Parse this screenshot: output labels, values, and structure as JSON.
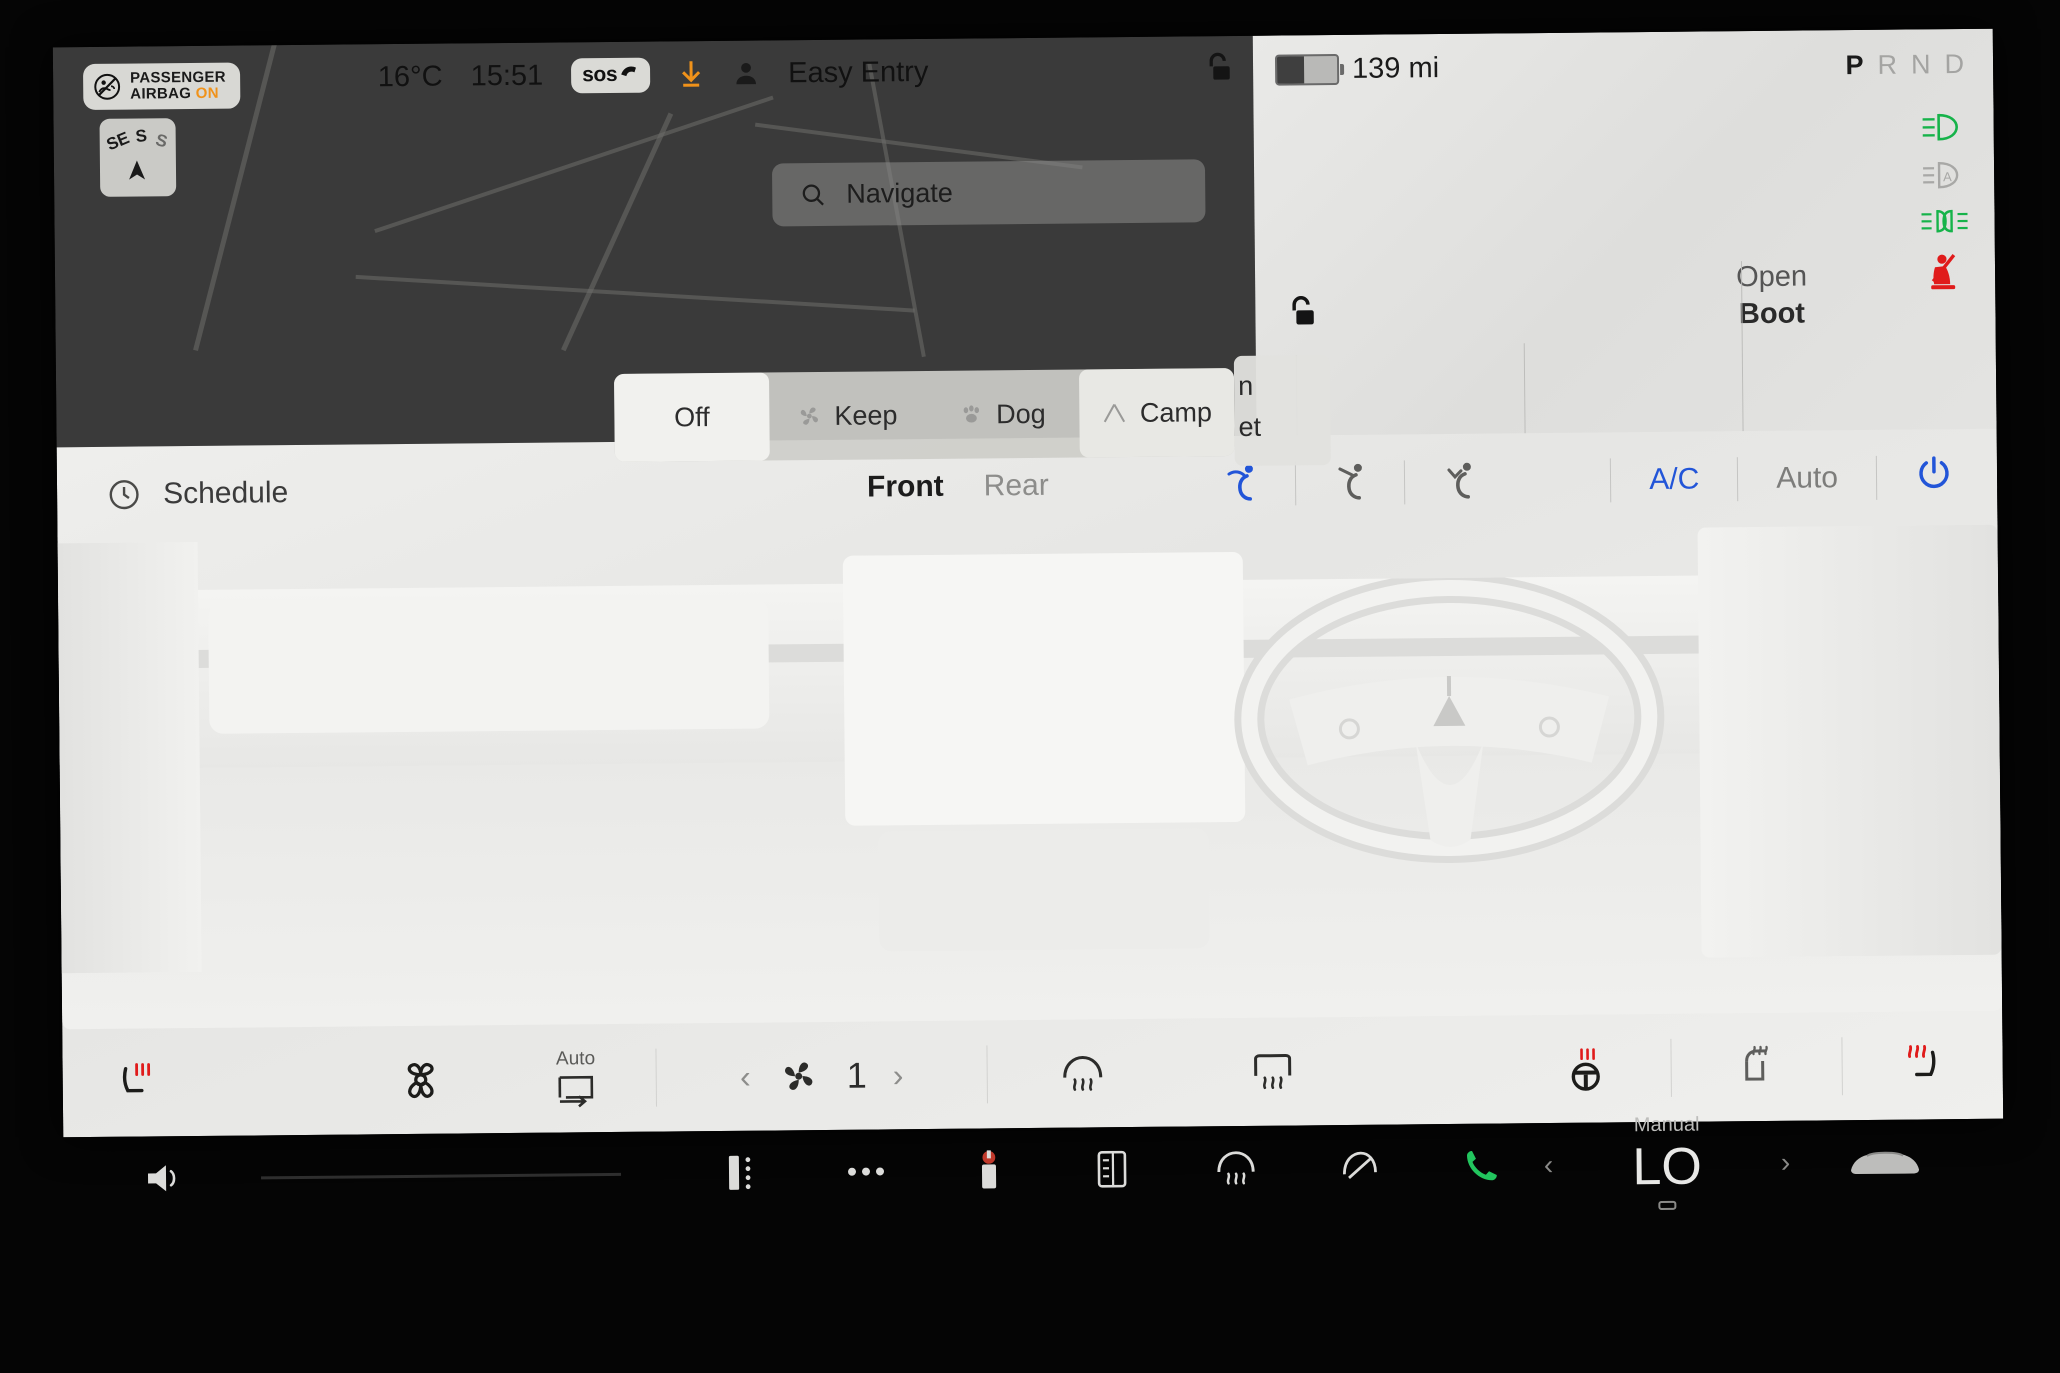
{
  "status_bar": {
    "airbag_line1": "PASSENGER",
    "airbag_line2": "AIRBAG",
    "airbag_state": "ON",
    "airbag_icon": "passenger-airbag-off-icon",
    "compass_primary": "SE",
    "compass_s": "S",
    "compass_s2": "S",
    "compass_arrow_icon": "navigation-arrow-icon",
    "temperature": "16°C",
    "clock": "15:51",
    "sos_label": "sos",
    "sos_icon": "phone-handset-icon",
    "download_icon": "software-update-download-icon",
    "profile_icon": "person-icon",
    "profile_name": "Easy Entry",
    "lock_icon": "unlocked-padlock-icon"
  },
  "navigation": {
    "search_icon": "search-icon",
    "placeholder": "Navigate"
  },
  "car_panel": {
    "battery_icon": "battery-icon",
    "battery_percent": 45,
    "range": "139 mi",
    "gears": [
      {
        "letter": "P",
        "active": true
      },
      {
        "letter": "R",
        "active": false
      },
      {
        "letter": "N",
        "active": false
      },
      {
        "letter": "D",
        "active": false
      }
    ],
    "telltales": [
      {
        "name": "low-beam-headlight-icon",
        "color": "#16b34a",
        "state": "on"
      },
      {
        "name": "auto-headlight-icon",
        "color": "#9e9e9c",
        "state": "off"
      },
      {
        "name": "parking-lights-icon",
        "color": "#16b34a",
        "state": "on"
      },
      {
        "name": "seatbelt-warning-icon",
        "color": "#e01b1b",
        "state": "on"
      }
    ],
    "boot_line1": "Open",
    "boot_line2": "Boot",
    "lock_icon": "unlocked-padlock-icon"
  },
  "climate_modes": {
    "options": [
      {
        "label": "Off",
        "icon": "",
        "selected": true
      },
      {
        "label": "Keep",
        "icon": "fan-icon",
        "selected": false
      },
      {
        "label": "Dog",
        "icon": "paw-icon",
        "selected": false
      },
      {
        "label": "Camp",
        "icon": "tent-icon",
        "selected": false
      }
    ],
    "keep_overlay_line1": "n",
    "keep_overlay_line2": "et"
  },
  "climate": {
    "schedule_icon": "clock-icon",
    "schedule_label": "Schedule",
    "zones": [
      {
        "label": "Front",
        "active": true
      },
      {
        "label": "Rear",
        "active": false
      }
    ],
    "airflow": [
      {
        "name": "airflow-face-icon",
        "active": true
      },
      {
        "name": "airflow-face-feet-icon",
        "active": false
      },
      {
        "name": "airflow-feet-icon",
        "active": false
      }
    ],
    "ac_label": "A/C",
    "ac_active": true,
    "auto_label": "Auto",
    "auto_active": false,
    "power_icon": "power-icon",
    "power_active": true,
    "bottom": {
      "left_seat_heater_icon": "seat-heater-left-icon",
      "bioweapon_icon": "bioweapon-defense-mode-icon",
      "recirculation_label": "Auto",
      "recirculation_icon": "air-recirculation-icon",
      "fan_prev_icon": "chevron-left-icon",
      "fan_icon": "fan-speed-icon",
      "fan_speed": "1",
      "fan_next_icon": "chevron-right-icon",
      "front_defrost_icon": "front-defrost-icon",
      "rear_defrost_icon": "rear-defrost-icon",
      "steering_wheel_heater_icon": "heated-steering-wheel-icon",
      "wiper_heater_icon": "wiper-blade-heater-icon",
      "right_seat_heater_icon": "seat-heater-right-icon"
    }
  },
  "app_bar": {
    "volume_icon": "volume-icon",
    "car_controls_icon": "car-controls-icon",
    "apps_icon": "apps-grid-icon",
    "charging_icon": "charging-station-icon",
    "media_icon": "media-player-icon",
    "front_defrost_icon": "front-defrost-icon",
    "wiper_icon": "wiper-icon",
    "phone_icon": "phone-icon",
    "temp_mode": "Manual",
    "temp_value": "LO",
    "temp_prev_icon": "chevron-left-icon",
    "temp_next_icon": "chevron-right-icon",
    "vehicle_icon": "tesla-car-icon"
  },
  "colors": {
    "accent_blue": "#2255d8",
    "warning_red": "#e01b1b",
    "indicator_green": "#16b34a",
    "amber": "#f0921a"
  }
}
